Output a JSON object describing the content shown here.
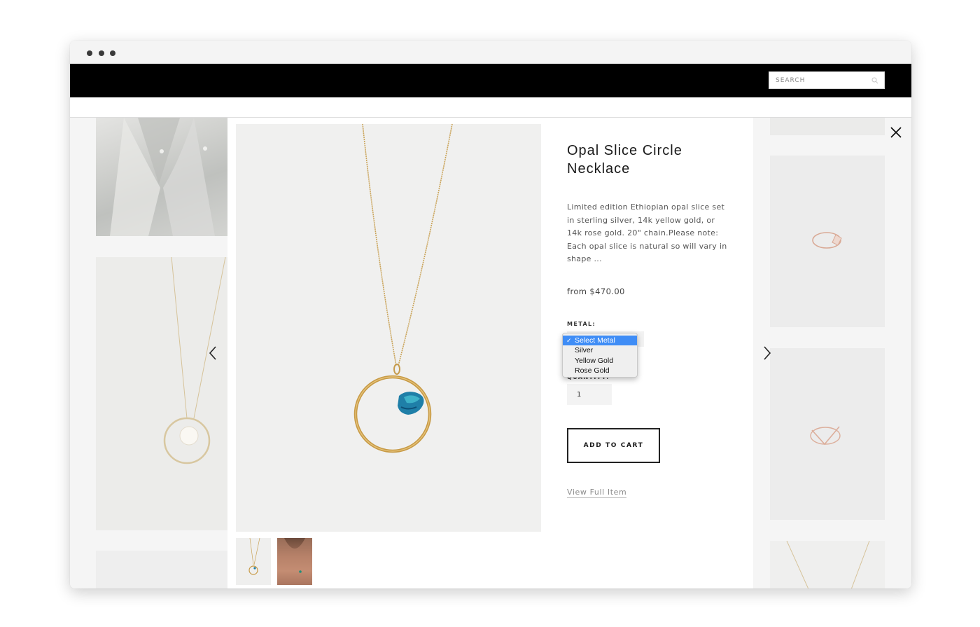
{
  "window": {
    "controls": [
      "window-dot",
      "window-dot",
      "window-dot"
    ]
  },
  "header": {
    "search": {
      "placeholder": "SEARCH",
      "value": "",
      "icon": "search-icon"
    }
  },
  "modal": {
    "close_icon": "close-icon",
    "nav": {
      "prev_icon": "chevron-left-icon",
      "next_icon": "chevron-right-icon"
    },
    "product": {
      "title": "Opal Slice Circle Necklace",
      "description": "Limited edition Ethiopian opal slice set in sterling silver, 14k yellow gold, or 14k rose gold. 20\" chain.Please note: Each opal slice is natural so will vary in shape ...",
      "price": "from $470.00",
      "metal": {
        "label": "METAL:",
        "selected": "Select Metal",
        "options": [
          "Select Metal",
          "Silver",
          "Yellow Gold",
          "Rose Gold"
        ]
      },
      "quantity": {
        "label": "QUANTITY:",
        "value": "1"
      },
      "add_to_cart_label": "ADD TO CART",
      "view_full_item_label": "View Full Item"
    },
    "thumbnails": [
      "necklace-thumbnail",
      "model-thumbnail"
    ]
  },
  "colors": {
    "header_bg": "#000000",
    "dropdown_highlight": "#3f8df6",
    "gold": "#c9a45c",
    "opal_blue": "#1f7fa8"
  }
}
